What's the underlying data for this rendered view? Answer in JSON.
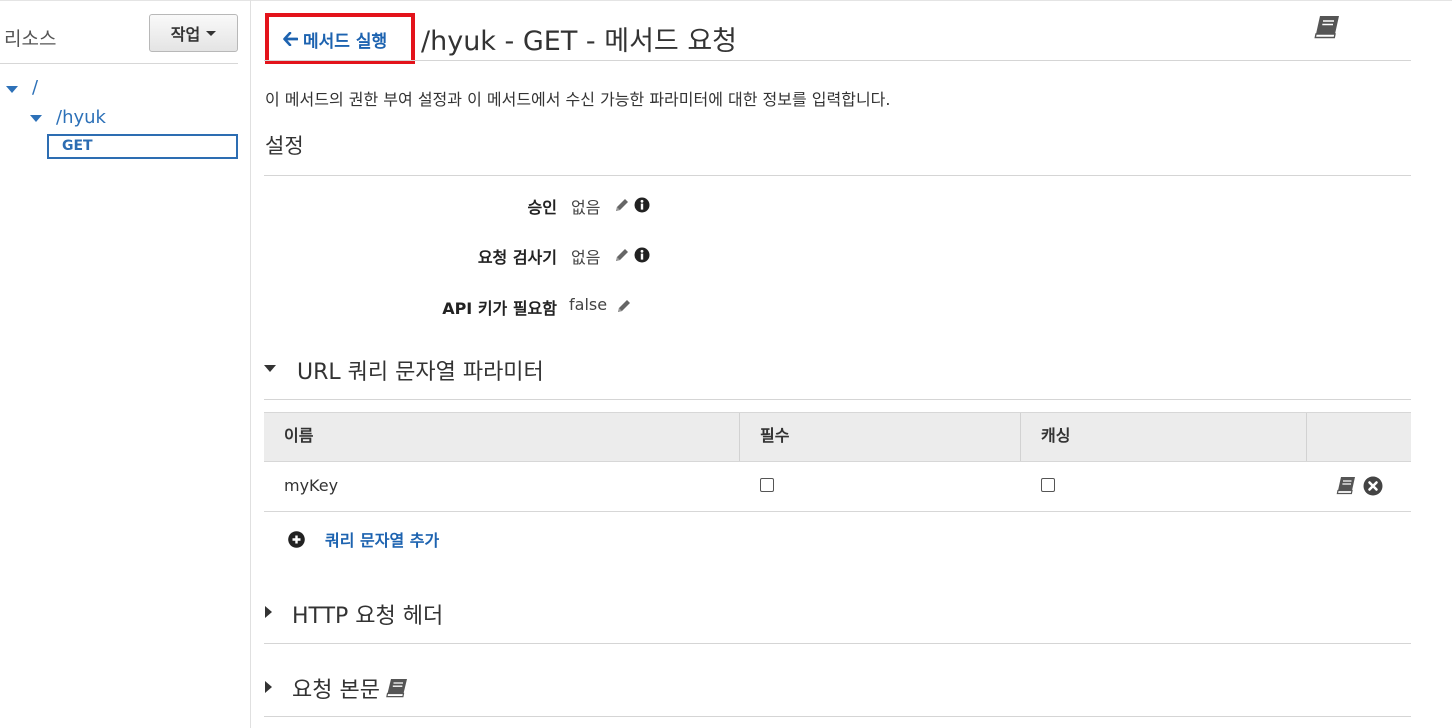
{
  "sidebar": {
    "title": "리소스",
    "actions_label": "작업",
    "tree": {
      "root_label": "/",
      "child_label": "/hyuk",
      "method_label": "GET"
    }
  },
  "header": {
    "back_label": "메서드 실행",
    "title": "/hyuk - GET - 메서드 요청"
  },
  "description": "이 메서드의 권한 부여 설정과 이 메서드에서 수신 가능한 파라미터에 대한 정보를 입력합니다.",
  "settings": {
    "heading": "설정",
    "authorization": {
      "label": "승인",
      "value": "없음"
    },
    "validator": {
      "label": "요청 검사기",
      "value": "없음"
    },
    "api_key": {
      "label": "API 키가 필요함",
      "value": "false"
    }
  },
  "query_params": {
    "title": "URL 쿼리 문자열 파라미터",
    "columns": [
      "이름",
      "필수",
      "캐싱"
    ],
    "rows": [
      {
        "name": "myKey",
        "required": false,
        "caching": false
      }
    ],
    "add_label": "쿼리 문자열 추가"
  },
  "http_headers": {
    "title": "HTTP 요청 헤더"
  },
  "request_body": {
    "title": "요청 본문"
  },
  "colors": {
    "link": "#1d63b0",
    "highlight": "#e3131b",
    "table_header_bg": "#ececec"
  },
  "icons": [
    "chevron-down-icon",
    "arrow-left-icon",
    "book-icon",
    "pencil-icon",
    "info-icon",
    "remove-icon",
    "plus-icon",
    "caret-right-icon"
  ]
}
